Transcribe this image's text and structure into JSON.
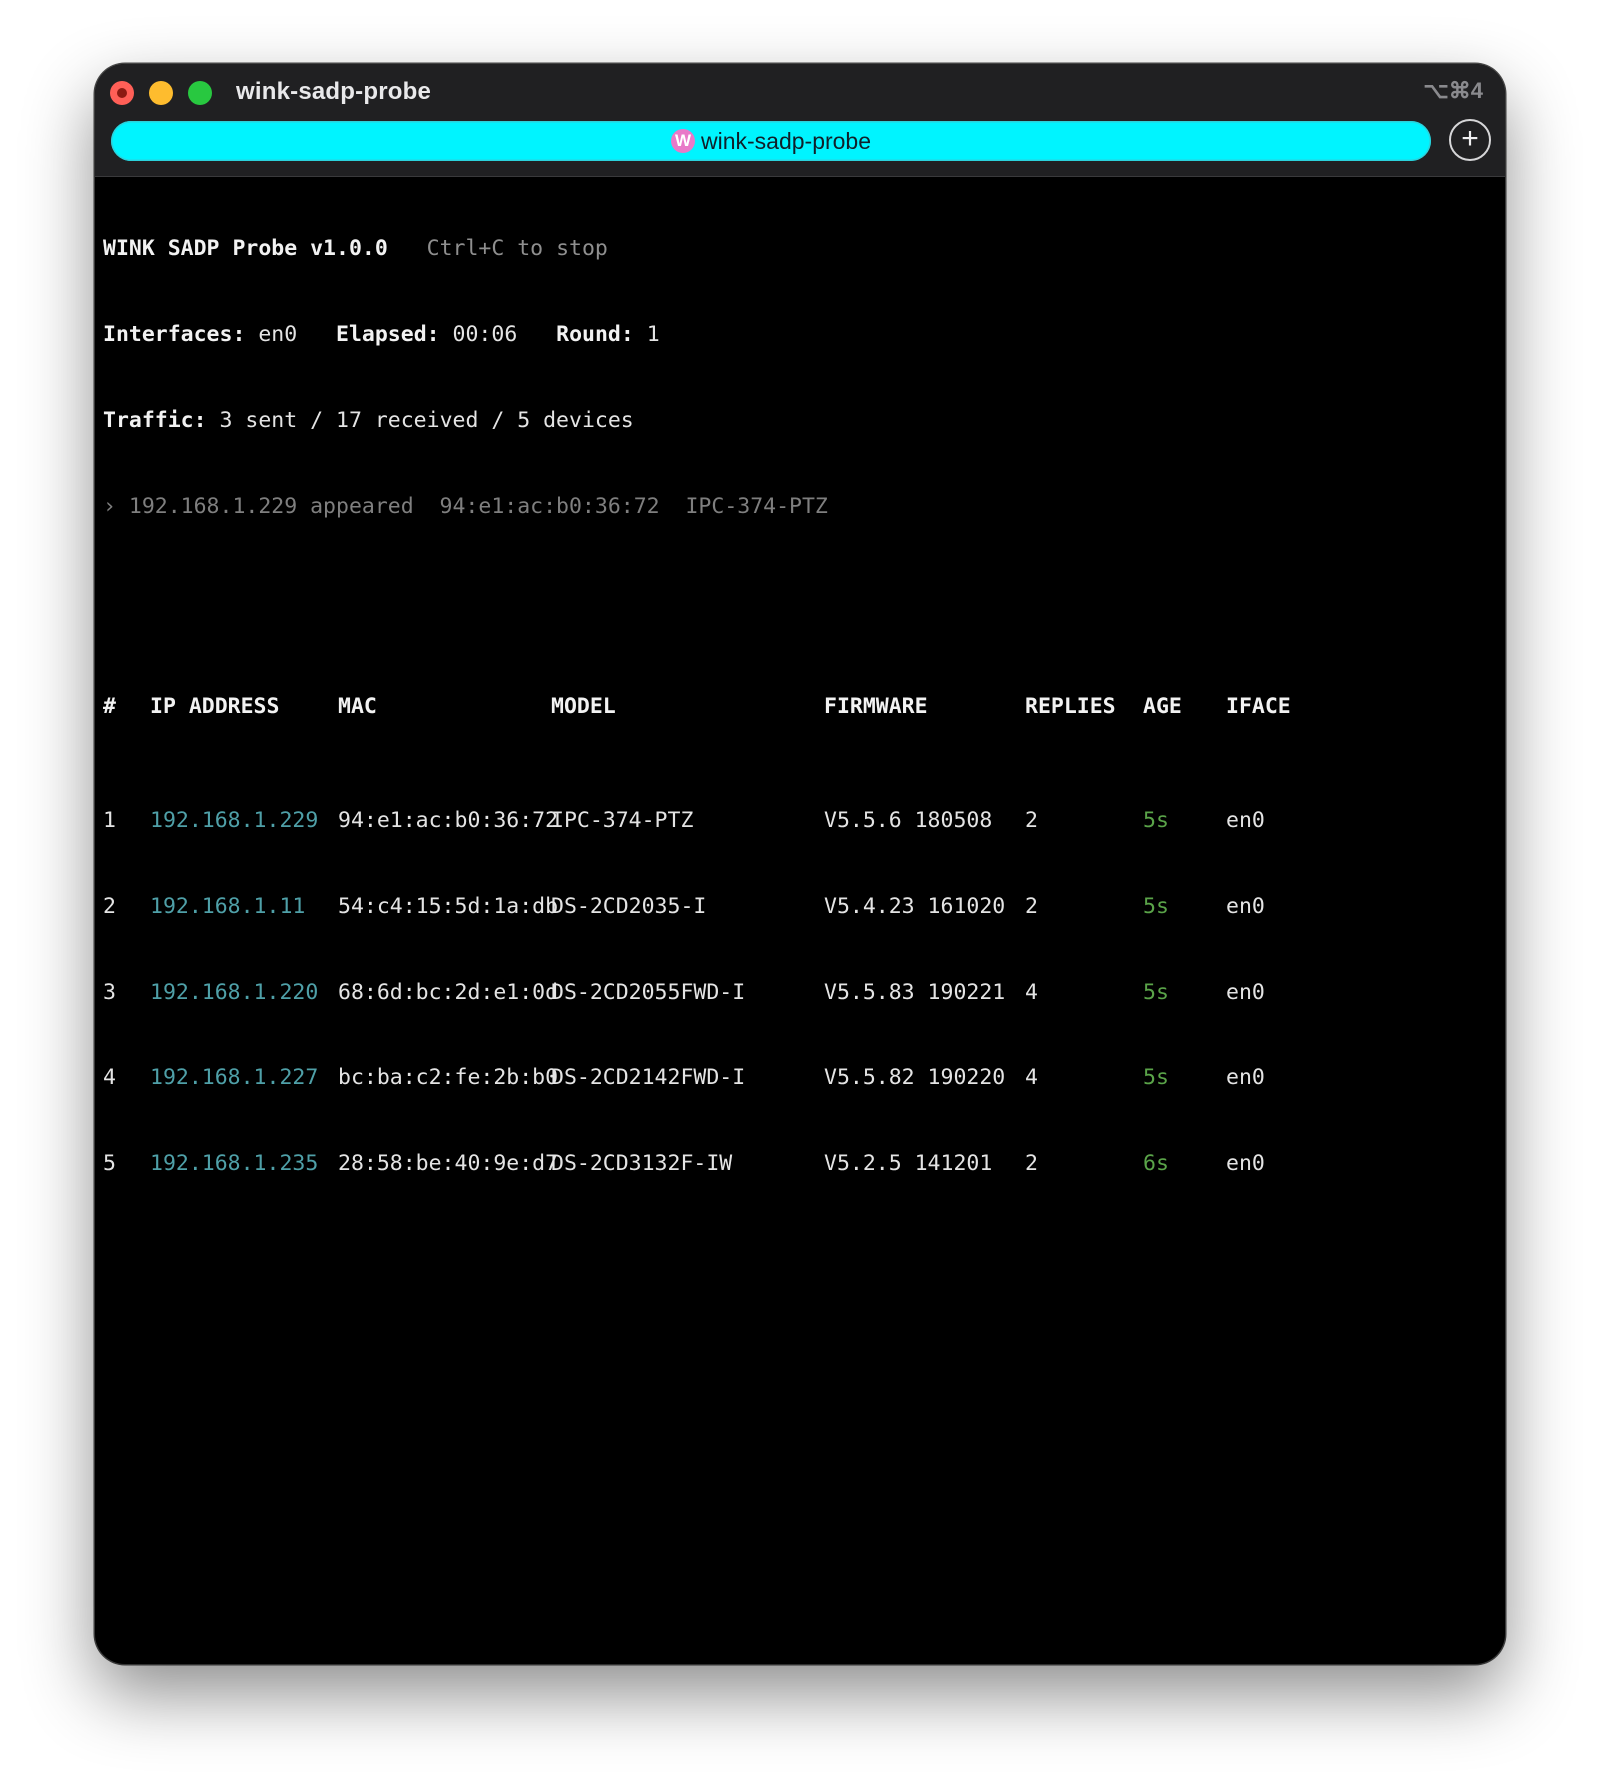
{
  "window": {
    "title": "wink-sadp-probe",
    "shortcut": "⌥⌘4"
  },
  "tab": {
    "icon_letter": "W",
    "label": "wink-sadp-probe",
    "new_tab_symbol": "+"
  },
  "status": {
    "app_name": "WINK SADP Probe v1.0.0",
    "hint": "Ctrl+C to stop",
    "interfaces_label": "Interfaces:",
    "interfaces_value": "en0",
    "elapsed_label": "Elapsed:",
    "elapsed_value": "00:06",
    "round_label": "Round:",
    "round_value": "1",
    "traffic_label": "Traffic:",
    "traffic_value": "3 sent / 17 received / 5 devices",
    "event": "› 192.168.1.229 appeared  94:e1:ac:b0:36:72  IPC-374-PTZ"
  },
  "table": {
    "headers": [
      "#",
      "IP ADDRESS",
      "MAC",
      "MODEL",
      "FIRMWARE",
      "REPLIES",
      "AGE",
      "IFACE"
    ],
    "rows": [
      [
        "1",
        "192.168.1.229",
        "94:e1:ac:b0:36:72",
        "IPC-374-PTZ",
        "V5.5.6 180508",
        "2",
        "5s",
        "en0"
      ],
      [
        "2",
        "192.168.1.11",
        "54:c4:15:5d:1a:db",
        "DS-2CD2035-I",
        "V5.4.23 161020",
        "2",
        "5s",
        "en0"
      ],
      [
        "3",
        "192.168.1.220",
        "68:6d:bc:2d:e1:0d",
        "DS-2CD2055FWD-I",
        "V5.5.83 190221",
        "4",
        "5s",
        "en0"
      ],
      [
        "4",
        "192.168.1.227",
        "bc:ba:c2:fe:2b:b0",
        "DS-2CD2142FWD-I",
        "V5.5.82 190220",
        "4",
        "5s",
        "en0"
      ],
      [
        "5",
        "192.168.1.235",
        "28:58:be:40:9e:d7",
        "DS-2CD3132F-IW",
        "V5.2.5 141201",
        "2",
        "6s",
        "en0"
      ]
    ]
  },
  "colors": {
    "tab_background": "#00f4ff",
    "ip_text": "#4fa0a8",
    "age_text": "#5aa449",
    "terminal_background": "#000000"
  }
}
